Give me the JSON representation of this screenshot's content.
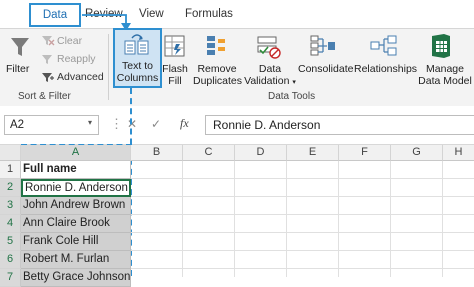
{
  "tabs": [
    "Data",
    "Review",
    "View",
    "Formulas"
  ],
  "sort_filter": {
    "filter_label": "Filter",
    "clear_label": "Clear",
    "reapply_label": "Reapply",
    "advanced_label": "Advanced",
    "group_label": "Sort & Filter"
  },
  "data_tools": {
    "text_to_columns_line1": "Text to",
    "text_to_columns_line2": "Columns",
    "flash_fill_line1": "Flash",
    "flash_fill_line2": "Fill",
    "remove_duplicates_line1": "Remove",
    "remove_duplicates_line2": "Duplicates",
    "data_validation_line1": "Data",
    "data_validation_line2": "Validation",
    "consolidate_label": "Consolidate",
    "relationships_label": "Relationships",
    "manage_model_line1": "Manage",
    "manage_model_line2": "Data Model",
    "group_label": "Data Tools"
  },
  "formula_bar": {
    "name_box": "A2",
    "cancel_symbol": "✕",
    "enter_symbol": "✓",
    "fx_symbol": "fx",
    "content": "Ronnie D. Anderson"
  },
  "columns": [
    "A",
    "B",
    "C",
    "D",
    "E",
    "F",
    "G",
    "H"
  ],
  "rows": [
    "1",
    "2",
    "3",
    "4",
    "5",
    "6",
    "7"
  ],
  "cells_a": [
    "Full name",
    "Ronnie D. Anderson",
    "John Andrew Brown",
    "Ann Claire Brook",
    "Frank Cole Hill",
    "Robert M. Furlan",
    "Betty Grace Johnson"
  ],
  "colors": {
    "accent": "#2e8fd0",
    "selection": "#d0d0d0",
    "excel_green": "#217346"
  }
}
